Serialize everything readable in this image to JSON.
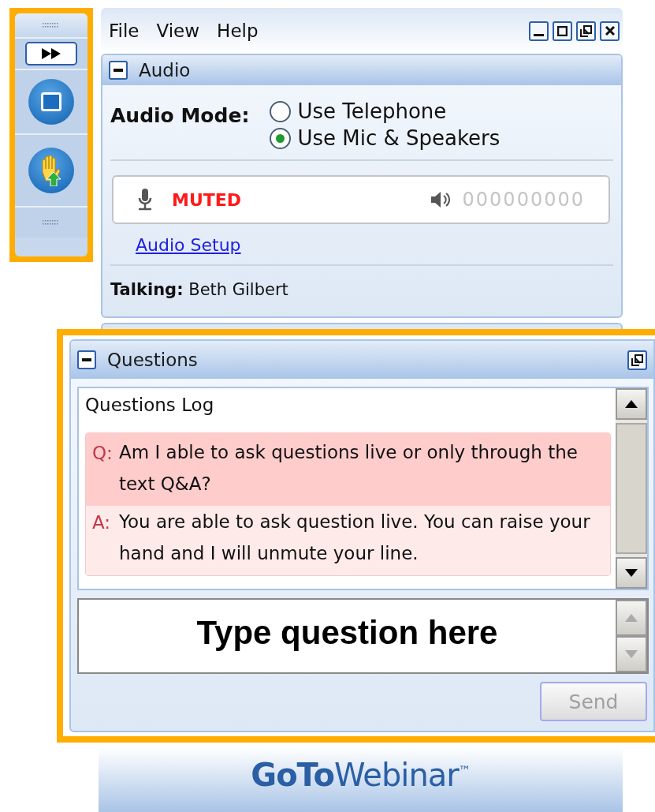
{
  "menu": [
    "File",
    "View",
    "Help"
  ],
  "audio": {
    "title": "Audio",
    "mode_label": "Audio Mode:",
    "options": [
      {
        "label": "Use Telephone",
        "selected": false
      },
      {
        "label": "Use Mic & Speakers",
        "selected": true
      }
    ],
    "mic_status": "MUTED",
    "speaker_reading": "000000000",
    "setup_link": "Audio Setup",
    "talking_label": "Talking:",
    "talking_name": "Beth Gilbert"
  },
  "questions": {
    "title": "Questions",
    "log_title": "Questions Log",
    "entries": [
      {
        "kind": "question",
        "prefix": "Q:",
        "text": "Am I able to ask questions live or only through the text Q&A?"
      },
      {
        "kind": "answer",
        "prefix": "A:",
        "text": "You are able to ask question live. You can raise your hand and I will unmute your line."
      }
    ],
    "input": {
      "placeholder": "Type question here"
    },
    "send": {
      "label": "Send",
      "disabled": true
    }
  },
  "logo": "**GoTo**Webinar$^{™}$"
}
